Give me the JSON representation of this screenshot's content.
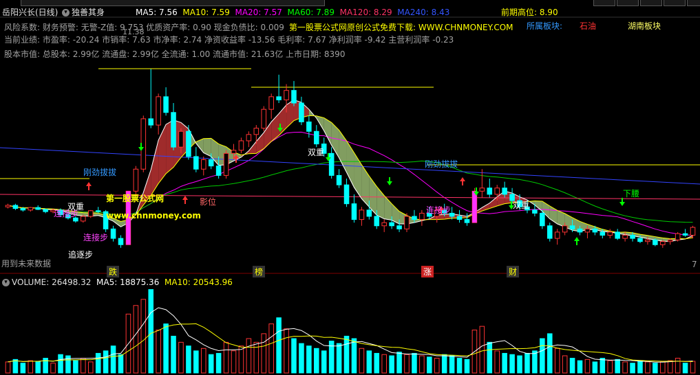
{
  "header": {
    "stock_title": "岳阳兴长(日线)",
    "indicator_name": "独善其身",
    "ma": [
      {
        "label": "MA5: 7.56",
        "color": "#ffffff"
      },
      {
        "label": "MA10: 7.59",
        "color": "#ffff00"
      },
      {
        "label": "MA20: 7.57",
        "color": "#ff00ff"
      },
      {
        "label": "MA60: 7.89",
        "color": "#00ff00"
      },
      {
        "label": "MA120: 8.29",
        "color": "#ff3366"
      },
      {
        "label": "MA240: 8.43",
        "color": "#3355ff"
      }
    ],
    "prev_high": "前期高位: 8.90"
  },
  "info": {
    "line1": "风险系数: 财务预警: 无警-Z值: 9.753 优质资产率: 0.90 现金负债比: 0.009",
    "line2": "当前业绩: 市盈率: -20.24 市销率: 7.63 市净率: 2.74 净资收益率 -13.56 毛利率: 7.67 净利润率 -9.42 主营利润率 -0.23",
    "line3": "股本市值: 总股本: 2.99亿 流通盘: 2.99亿 全流通: 1.00 流通市值: 21.63亿 上市日期: 8390",
    "promo": "第一股票公式网原创公式免费下载: WWW.CHNMONEY.COM",
    "sector_label": "所属板块:",
    "sector1": "石油",
    "sector2": "湖南板块",
    "price_top": "11.38"
  },
  "annotations": {
    "watermark_cn": "第一股票公式网",
    "watermark_url": "www.chnmoney.com",
    "signals": {
      "lianjiebu": "连接步",
      "zhuizhubu": "追逐步",
      "gangjinbaba": "刚劲拔拔",
      "gangjinbaba2": "刚劲拔拔",
      "shuangchong": "双重",
      "shuangchong2": "双重",
      "shuangchong3": "双重",
      "xiayao": "下腰",
      "luoying": "影位"
    },
    "future_data": "用到未来数据",
    "bottom_marks": [
      "跌",
      "榜",
      "涨",
      "财"
    ],
    "scale_right": "7"
  },
  "volume": {
    "label": "VOLUME: 26498.32",
    "ma5": "MA5: 18875.36",
    "ma10": "MA10: 20543.96"
  },
  "colors": {
    "up": "#ff3333",
    "down": "#00ffff",
    "ribbon_red": "#b03030",
    "ribbon_green": "#8fae6a"
  },
  "chart_data": {
    "type": "candlestick",
    "candles": [
      [
        7.0,
        7.1,
        6.95,
        7.05
      ],
      [
        7.05,
        7.1,
        6.9,
        6.95
      ],
      [
        6.95,
        7.0,
        6.85,
        6.9
      ],
      [
        6.9,
        7.0,
        6.85,
        6.98
      ],
      [
        6.98,
        7.05,
        6.9,
        6.92
      ],
      [
        6.92,
        6.95,
        6.8,
        6.85
      ],
      [
        6.85,
        6.95,
        6.8,
        6.9
      ],
      [
        6.9,
        6.95,
        6.7,
        6.75
      ],
      [
        6.75,
        6.8,
        6.6,
        6.65
      ],
      [
        6.65,
        6.7,
        6.5,
        6.55
      ],
      [
        6.55,
        6.75,
        6.5,
        6.7
      ],
      [
        6.7,
        6.9,
        6.65,
        6.88
      ],
      [
        6.88,
        7.0,
        6.8,
        6.85
      ],
      [
        6.85,
        6.9,
        6.2,
        6.3
      ],
      [
        6.3,
        6.4,
        5.9,
        6.0
      ],
      [
        6.0,
        6.1,
        5.7,
        5.8
      ],
      [
        5.8,
        7.5,
        5.8,
        7.5
      ],
      [
        7.5,
        8.3,
        7.4,
        8.2
      ],
      [
        8.2,
        9.9,
        8.1,
        9.8
      ],
      [
        9.8,
        11.38,
        9.5,
        9.6
      ],
      [
        9.6,
        10.6,
        9.3,
        10.5
      ],
      [
        10.5,
        10.8,
        9.9,
        10.0
      ],
      [
        10.0,
        10.3,
        8.8,
        8.9
      ],
      [
        8.9,
        9.5,
        8.7,
        9.4
      ],
      [
        9.4,
        9.6,
        8.5,
        8.6
      ],
      [
        8.6,
        8.9,
        8.1,
        8.2
      ],
      [
        8.2,
        8.6,
        8.0,
        8.5
      ],
      [
        8.5,
        8.7,
        8.2,
        8.3
      ],
      [
        8.3,
        8.6,
        7.9,
        8.0
      ],
      [
        8.0,
        8.8,
        7.9,
        8.7
      ],
      [
        8.7,
        9.0,
        8.5,
        8.8
      ],
      [
        8.8,
        9.2,
        8.7,
        9.1
      ],
      [
        9.1,
        9.4,
        8.9,
        9.3
      ],
      [
        9.3,
        9.6,
        9.0,
        9.5
      ],
      [
        9.5,
        10.2,
        9.4,
        10.1
      ],
      [
        10.1,
        10.6,
        9.8,
        10.5
      ],
      [
        10.5,
        11.2,
        10.3,
        10.4
      ],
      [
        10.4,
        10.9,
        10.0,
        10.7
      ],
      [
        10.7,
        11.0,
        10.2,
        10.3
      ],
      [
        10.3,
        10.5,
        9.6,
        9.7
      ],
      [
        9.7,
        9.9,
        9.2,
        9.4
      ],
      [
        9.4,
        9.6,
        8.9,
        9.0
      ],
      [
        9.0,
        9.2,
        8.6,
        8.7
      ],
      [
        8.7,
        8.9,
        7.9,
        8.0
      ],
      [
        8.0,
        8.2,
        7.6,
        7.7
      ],
      [
        7.7,
        7.9,
        7.0,
        7.1
      ],
      [
        7.1,
        7.4,
        6.5,
        6.6
      ],
      [
        6.6,
        7.0,
        6.4,
        6.9
      ],
      [
        6.9,
        7.2,
        6.6,
        6.7
      ],
      [
        6.7,
        6.9,
        6.3,
        6.4
      ],
      [
        6.4,
        6.6,
        6.2,
        6.5
      ],
      [
        6.5,
        6.7,
        6.3,
        6.4
      ],
      [
        6.4,
        6.6,
        6.2,
        6.3
      ],
      [
        6.3,
        6.8,
        6.2,
        6.7
      ],
      [
        6.7,
        6.9,
        6.5,
        6.6
      ],
      [
        6.6,
        6.9,
        6.4,
        6.8
      ],
      [
        6.8,
        7.0,
        6.6,
        6.7
      ],
      [
        6.7,
        7.0,
        6.5,
        6.9
      ],
      [
        6.9,
        7.1,
        6.7,
        6.8
      ],
      [
        6.8,
        7.0,
        6.6,
        6.7
      ],
      [
        6.7,
        6.9,
        6.5,
        6.6
      ],
      [
        6.6,
        6.8,
        6.4,
        6.5
      ],
      [
        6.5,
        7.6,
        6.5,
        7.5
      ],
      [
        7.5,
        8.2,
        7.3,
        7.6
      ],
      [
        7.6,
        7.9,
        7.3,
        7.4
      ],
      [
        7.4,
        7.7,
        7.2,
        7.6
      ],
      [
        7.6,
        7.8,
        7.3,
        7.4
      ],
      [
        7.4,
        7.6,
        7.1,
        7.2
      ],
      [
        7.2,
        7.4,
        6.9,
        7.0
      ],
      [
        7.0,
        7.2,
        6.8,
        6.9
      ],
      [
        6.9,
        7.1,
        6.7,
        6.8
      ],
      [
        6.8,
        6.9,
        6.3,
        6.4
      ],
      [
        6.4,
        6.5,
        5.9,
        6.0
      ],
      [
        6.0,
        6.3,
        5.8,
        6.2
      ],
      [
        6.2,
        6.5,
        6.1,
        6.4
      ],
      [
        6.4,
        6.6,
        6.2,
        6.3
      ],
      [
        6.3,
        6.4,
        6.1,
        6.2
      ],
      [
        6.2,
        6.4,
        6.0,
        6.3
      ],
      [
        6.3,
        6.4,
        6.1,
        6.2
      ],
      [
        6.2,
        6.3,
        6.0,
        6.1
      ],
      [
        6.1,
        6.3,
        6.0,
        6.2
      ],
      [
        6.2,
        6.3,
        5.95,
        6.0
      ],
      [
        6.0,
        6.2,
        5.9,
        6.1
      ],
      [
        6.1,
        6.2,
        5.9,
        6.0
      ],
      [
        6.0,
        6.1,
        5.85,
        5.9
      ],
      [
        5.9,
        6.05,
        5.8,
        5.95
      ],
      [
        5.95,
        6.0,
        5.75,
        5.8
      ],
      [
        5.8,
        5.95,
        5.7,
        5.9
      ],
      [
        5.9,
        6.0,
        5.8,
        5.95
      ],
      [
        5.95,
        6.2,
        5.9,
        6.15
      ],
      [
        6.15,
        6.3,
        6.05,
        6.1
      ],
      [
        6.1,
        6.4,
        6.0,
        6.35
      ]
    ],
    "volume": [
      9000,
      11000,
      8000,
      10000,
      9500,
      12000,
      8000,
      15000,
      14000,
      10000,
      12000,
      9000,
      16000,
      18000,
      22000,
      15000,
      48000,
      55000,
      60000,
      68000,
      35000,
      40000,
      30000,
      25000,
      22000,
      18000,
      20000,
      15000,
      16000,
      25000,
      18000,
      22000,
      28000,
      25000,
      32000,
      40000,
      45000,
      36000,
      28000,
      24000,
      22000,
      20000,
      18000,
      26000,
      24000,
      30000,
      28000,
      20000,
      18000,
      16000,
      15000,
      14000,
      17000,
      15000,
      16000,
      14000,
      13000,
      12000,
      15000,
      14000,
      12000,
      11000,
      35000,
      38000,
      25000,
      18000,
      16000,
      15000,
      14000,
      16000,
      18000,
      28000,
      32000,
      20000,
      14000,
      12000,
      10000,
      11000,
      9000,
      12000,
      10000,
      11000,
      9000,
      8000,
      10000,
      9000,
      8000,
      9000,
      10000,
      12000,
      8000,
      9500
    ]
  }
}
